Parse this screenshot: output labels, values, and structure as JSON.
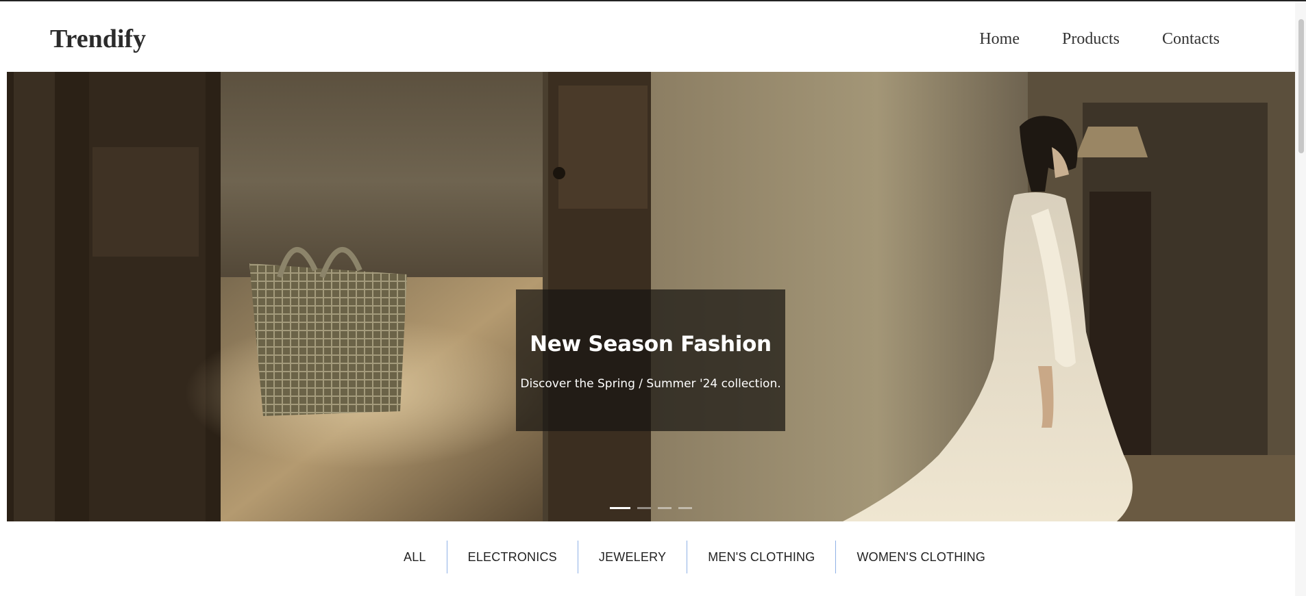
{
  "brand": {
    "logo": "Trendify"
  },
  "nav": {
    "items": [
      "Home",
      "Products",
      "Contacts"
    ]
  },
  "hero": {
    "title": "New Season Fashion",
    "subtitle": "Discover the Spring / Summer '24 collection.",
    "slide_count": 4,
    "active_slide": 0
  },
  "filters": [
    "ALL",
    "ELECTRONICS",
    "JEWELERY",
    "MEN'S CLOTHING",
    "WOMEN'S CLOTHING"
  ],
  "colors": {
    "separator": "#8fb1e6",
    "caption_bg": "rgba(25,22,18,0.72)"
  }
}
